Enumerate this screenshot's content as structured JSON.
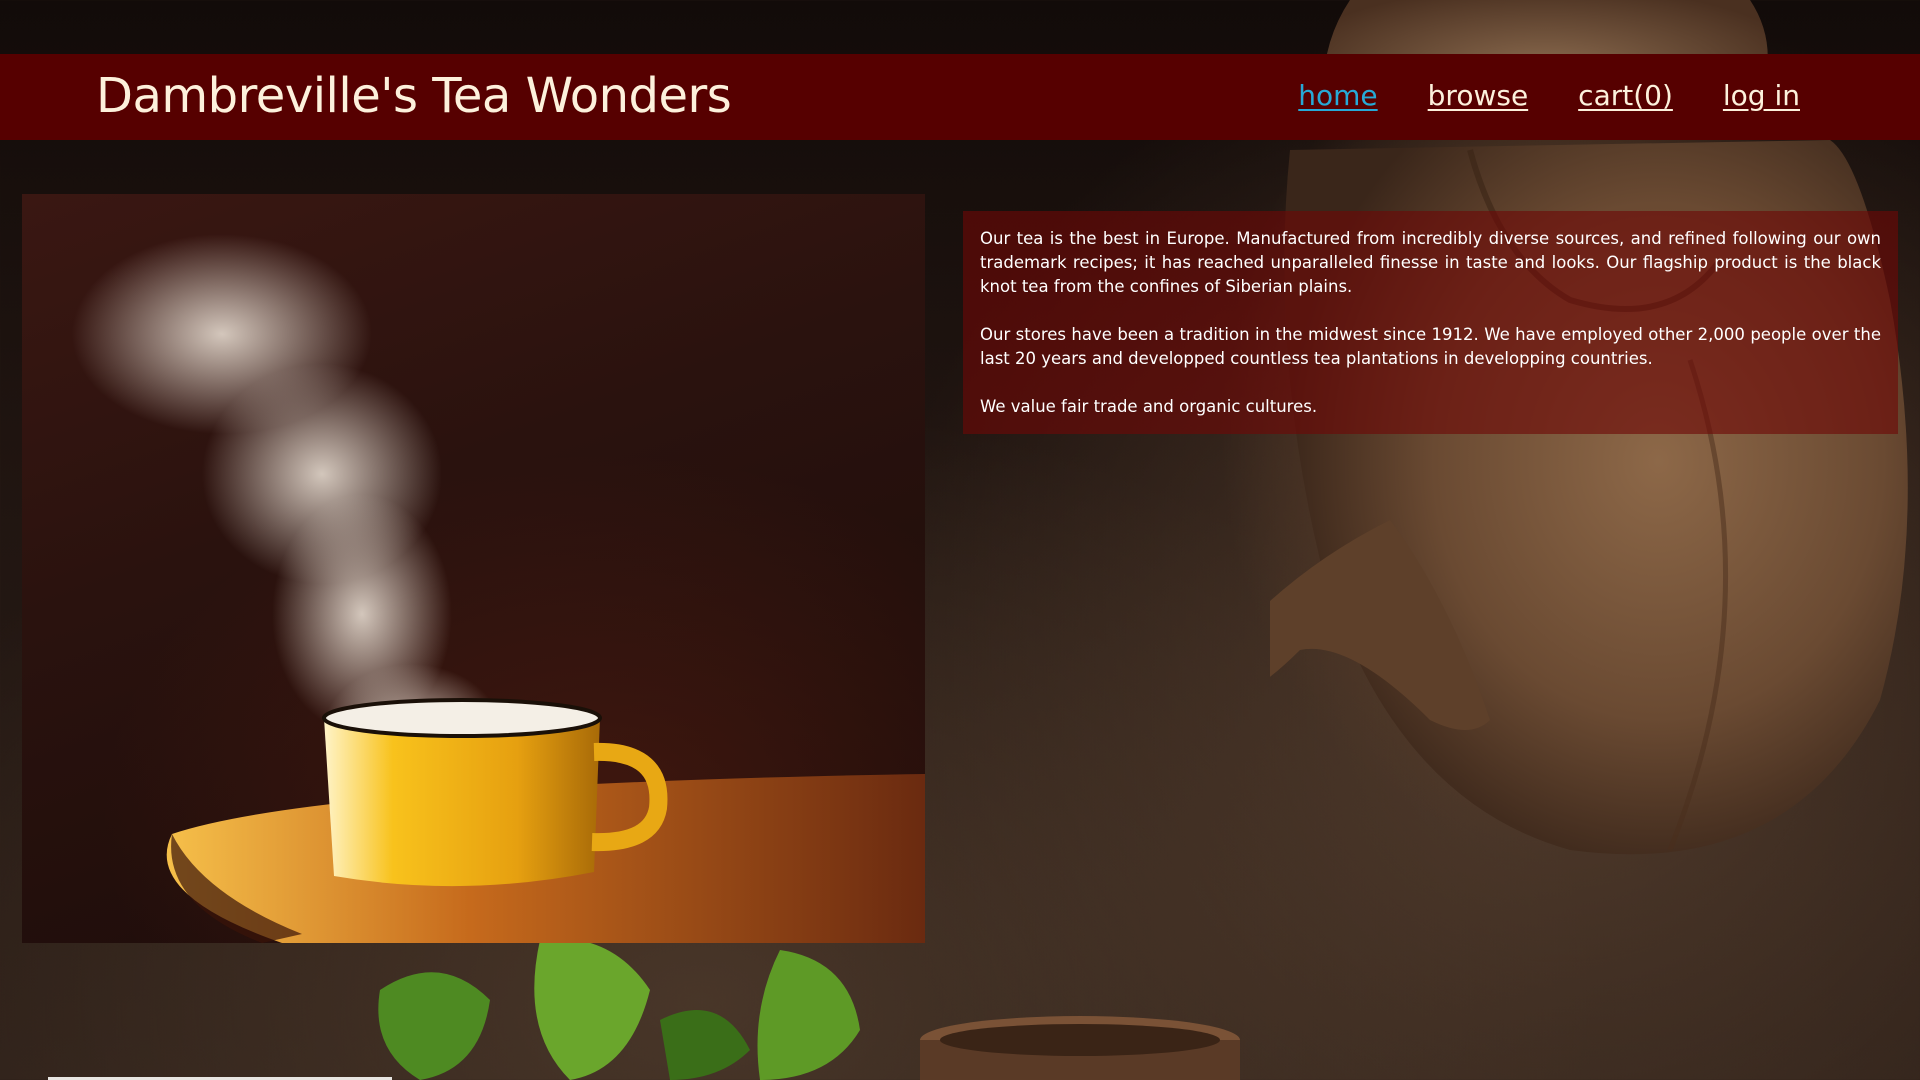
{
  "header": {
    "title": "Dambreville's Tea Wonders",
    "nav": [
      {
        "label": "home",
        "active": true
      },
      {
        "label": "browse",
        "active": false
      },
      {
        "label": "cart(0)",
        "active": false
      },
      {
        "label": "log in",
        "active": false
      }
    ]
  },
  "info": {
    "paragraphs": [
      "Our tea is the best in Europe. Manufactured from incredibly diverse sources, and refined following our own trademark recipes; it has reached unparalleled finesse in taste and looks. Our flagship product is the black knot tea from the confines of Siberian plains.",
      "Our stores have been a tradition in the midwest since 1912. We have employed other 2,000 people over the last 20 years and developped countless tea plantations in developping countries.",
      "We value fair trade and organic cultures."
    ]
  },
  "colors": {
    "header_bg": "#560000",
    "title_text": "#fdf1dc",
    "nav_active": "#27a9d6",
    "panel_bg": "#6e0806"
  },
  "images": {
    "hero": "steaming-yellow-tea-cup-photo",
    "background": "teapot-pouring-tea-photo"
  }
}
